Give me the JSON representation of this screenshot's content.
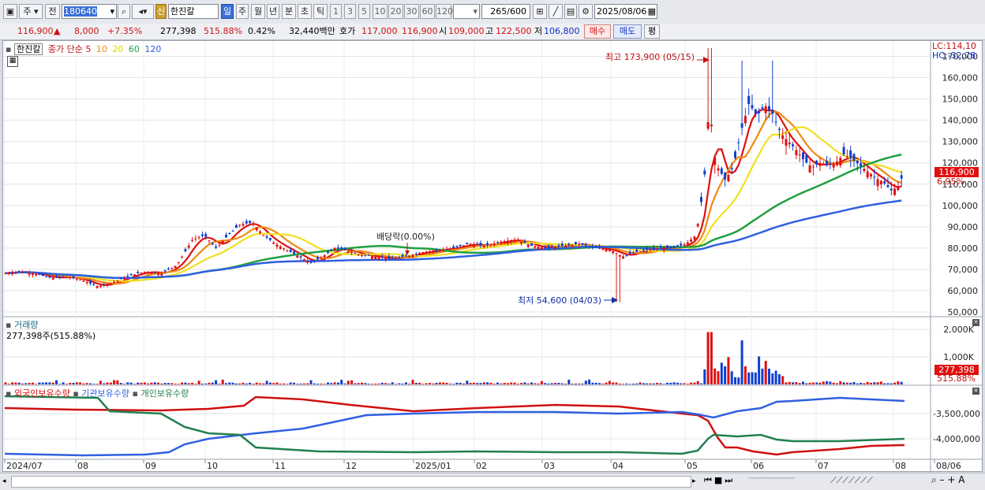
{
  "toolbar": {
    "btn_ju": "주",
    "btn_jeon": "전",
    "stock_code": "180640",
    "new_badge": "신",
    "stock_name": "한진칼",
    "periods": [
      "일",
      "주",
      "월",
      "년",
      "분",
      "초",
      "틱"
    ],
    "minutes": [
      "1",
      "3",
      "5",
      "10",
      "20",
      "30",
      "60",
      "120"
    ],
    "count": "265",
    "count_total": "/600",
    "date": "2025/08/06"
  },
  "quote": {
    "price": "116,900",
    "arrow": "▲",
    "change": "8,000",
    "change_pct": "+7.35%",
    "volume": "277,398",
    "volume_ratio": "515.88%",
    "turnover_pct": "0.42%",
    "amount": "32,440백만",
    "label_hoga": "호가",
    "ask": "117,000",
    "bid": "116,900",
    "label_open": "시",
    "open": "109,000",
    "label_high": "고",
    "high": "122,500",
    "label_low": "저",
    "low": "106,800",
    "buy_btn": "매수",
    "sell_btn": "매도",
    "avg_btn": "평"
  },
  "price_panel": {
    "stock_label": "한진칼",
    "ma_label": "종가 단순",
    "ma_periods": [
      "5",
      "10",
      "20",
      "60",
      "120"
    ],
    "ma_colors": [
      "#e01010",
      "#f08a10",
      "#f0e020",
      "#20a040",
      "#3060e0"
    ],
    "lc": "LC:114,10",
    "hc": "HC:-32,78",
    "high_annotation": "최고 173,900 (05/15)",
    "low_annotation": "최저 54,600 (04/03)",
    "dividend_annotation": "배당락(0.00%)",
    "price_tag": "116,900",
    "pct_tag": "6.95%",
    "y_ticks": [
      "170,000",
      "160,000",
      "150,000",
      "140,000",
      "130,000",
      "120,000",
      "110,000",
      "100,000",
      "90,000",
      "80,000",
      "70,000",
      "60,000",
      "50,000"
    ]
  },
  "volume_panel": {
    "title": "거래량",
    "value_text": "277,398주(515.88%)",
    "y_ticks": [
      "2,000K",
      "1,000K"
    ],
    "tag_value": "277,398",
    "tag_pct": "515.88%"
  },
  "holdings_panel": {
    "legend": [
      "외국인보유수량",
      "기관보유수량",
      "개인보유수량"
    ],
    "legend_colors": [
      "#d01010",
      "#3060e0",
      "#208050"
    ],
    "y_ticks": [
      "-3,500,000",
      "-4,000,000"
    ]
  },
  "x_axis": [
    "2024/07",
    "08",
    "09",
    "10",
    "11",
    "12",
    "2025/01",
    "02",
    "03",
    "04",
    "05",
    "06",
    "07",
    "08",
    "08/06"
  ],
  "chart_data": {
    "type": "candlestick",
    "y_range": [
      50000,
      175000
    ],
    "close_series_approx": [
      [
        0,
        68000
      ],
      [
        20,
        69000
      ],
      [
        40,
        68000
      ],
      [
        60,
        66000
      ],
      [
        80,
        66500
      ],
      [
        100,
        65000
      ],
      [
        120,
        62000
      ],
      [
        140,
        64000
      ],
      [
        160,
        67000
      ],
      [
        180,
        69000
      ],
      [
        200,
        68000
      ],
      [
        220,
        72000
      ],
      [
        240,
        84000
      ],
      [
        255,
        86000
      ],
      [
        270,
        80000
      ],
      [
        285,
        86000
      ],
      [
        300,
        91000
      ],
      [
        315,
        92000
      ],
      [
        330,
        86000
      ],
      [
        345,
        82000
      ],
      [
        360,
        79000
      ],
      [
        375,
        76000
      ],
      [
        390,
        73000
      ],
      [
        405,
        76000
      ],
      [
        420,
        80000
      ],
      [
        435,
        79000
      ],
      [
        450,
        77000
      ],
      [
        470,
        76000
      ],
      [
        490,
        75000
      ],
      [
        510,
        76000
      ],
      [
        530,
        78000
      ],
      [
        550,
        79000
      ],
      [
        570,
        80000
      ],
      [
        590,
        82000
      ],
      [
        610,
        81000
      ],
      [
        630,
        83000
      ],
      [
        650,
        84000
      ],
      [
        670,
        81000
      ],
      [
        690,
        80000
      ],
      [
        710,
        81000
      ],
      [
        730,
        82000
      ],
      [
        750,
        80000
      ],
      [
        770,
        79000
      ],
      [
        785,
        76000
      ],
      [
        800,
        78000
      ],
      [
        815,
        79000
      ],
      [
        830,
        80000
      ],
      [
        850,
        80000
      ],
      [
        865,
        82000
      ],
      [
        878,
        86000
      ],
      [
        888,
        110000
      ],
      [
        895,
        150000
      ],
      [
        900,
        125000
      ],
      [
        905,
        118000
      ],
      [
        915,
        112000
      ],
      [
        925,
        118000
      ],
      [
        935,
        135000
      ],
      [
        945,
        148000
      ],
      [
        955,
        142000
      ],
      [
        965,
        147000
      ],
      [
        975,
        143000
      ],
      [
        985,
        134000
      ],
      [
        995,
        130000
      ],
      [
        1005,
        126000
      ],
      [
        1015,
        121000
      ],
      [
        1025,
        118000
      ],
      [
        1035,
        120000
      ],
      [
        1045,
        119000
      ],
      [
        1055,
        120000
      ],
      [
        1065,
        124000
      ],
      [
        1075,
        122000
      ],
      [
        1085,
        119000
      ],
      [
        1095,
        116000
      ],
      [
        1105,
        113000
      ],
      [
        1115,
        111000
      ],
      [
        1125,
        107000
      ],
      [
        1135,
        109000
      ],
      [
        1142,
        116900
      ]
    ],
    "volume_max": 2000000,
    "last_volume": 277398
  }
}
